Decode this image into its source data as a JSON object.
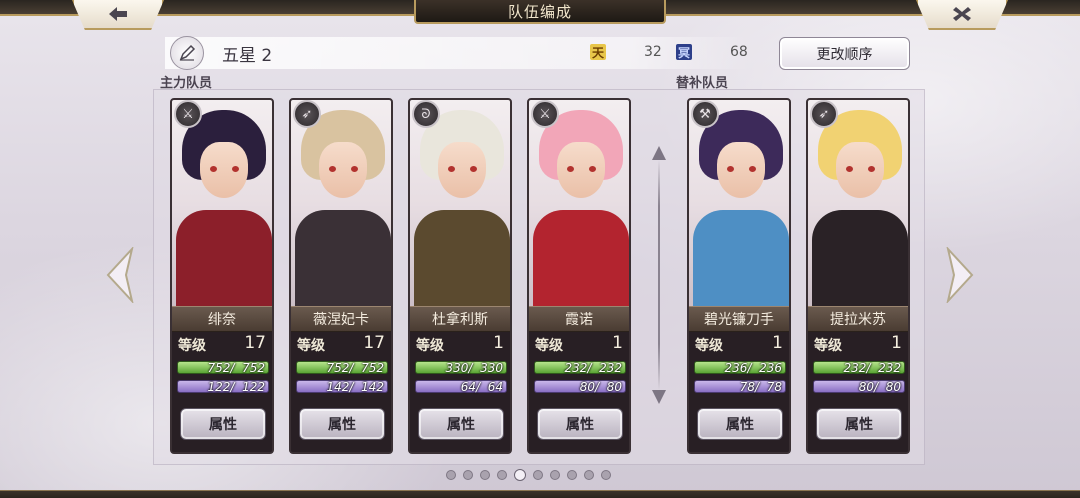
{
  "header": {
    "title": "队伍编成",
    "back_icon": "back-arrow-icon",
    "close_icon": "close-icon"
  },
  "team": {
    "name": "五星 2",
    "heaven_icon_glyph": "天",
    "heaven_value": "32",
    "hell_icon_glyph": "冥",
    "hell_value": "68",
    "reorder_label": "更改顺序"
  },
  "sections": {
    "main_label": "主力队员",
    "sub_label": "替补队员"
  },
  "cards": [
    {
      "name": "绯奈",
      "level_label": "等级",
      "level": "17",
      "hp": "752/  752",
      "mp": "122/  122",
      "attr_label": "属性",
      "weapon": "sword-icon",
      "palette": {
        "hair": "#2b1f3d",
        "body": "#8c1f2a"
      }
    },
    {
      "name": "薇涅妃卡",
      "level_label": "等级",
      "level": "17",
      "hp": "752/  752",
      "mp": "142/  142",
      "attr_label": "属性",
      "weapon": "bow-icon",
      "palette": {
        "hair": "#d9c3a0",
        "body": "#3a3036"
      }
    },
    {
      "name": "杜拿利斯",
      "level_label": "等级",
      "level": "1",
      "hp": "330/  330",
      "mp": "64/  64",
      "attr_label": "属性",
      "weapon": "whip-icon",
      "palette": {
        "hair": "#e9e6dc",
        "body": "#5b4a2f"
      }
    },
    {
      "name": "霞诺",
      "level_label": "等级",
      "level": "1",
      "hp": "232/  232",
      "mp": "80/  80",
      "attr_label": "属性",
      "weapon": "sword-icon",
      "palette": {
        "hair": "#f2a6b8",
        "body": "#b3242f"
      }
    },
    {
      "name": "碧光镰刀手",
      "level_label": "等级",
      "level": "1",
      "hp": "236/  236",
      "mp": "78/  78",
      "attr_label": "属性",
      "weapon": "axe-icon",
      "palette": {
        "hair": "#3d2a5a",
        "body": "#4e8fc4"
      }
    },
    {
      "name": "提拉米苏",
      "level_label": "等级",
      "level": "1",
      "hp": "232/  232",
      "mp": "80/  80",
      "attr_label": "属性",
      "weapon": "bow-icon",
      "palette": {
        "hair": "#f1d272",
        "body": "#2a2226"
      }
    }
  ],
  "pagination": {
    "total": 10,
    "active_index": 4
  }
}
